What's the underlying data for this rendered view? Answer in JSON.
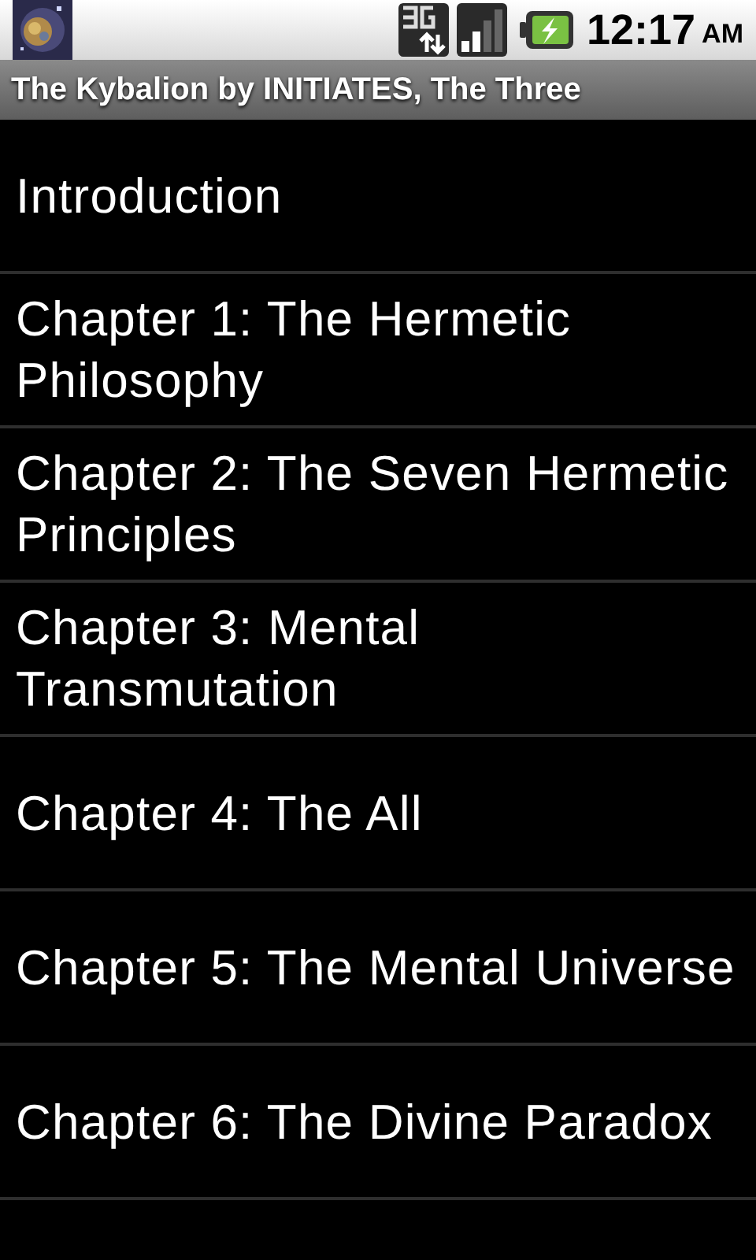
{
  "status_bar": {
    "time": "12:17",
    "meridiem": "AM"
  },
  "title_bar": {
    "title": "The Kybalion by INITIATES, The Three"
  },
  "chapters": [
    {
      "title": "Introduction"
    },
    {
      "title": "Chapter 1: The Hermetic Philosophy"
    },
    {
      "title": "Chapter 2: The Seven Hermetic Principles"
    },
    {
      "title": "Chapter 3: Mental Transmutation"
    },
    {
      "title": "Chapter 4: The All"
    },
    {
      "title": "Chapter 5: The Mental Universe"
    },
    {
      "title": "Chapter 6: The Divine Paradox"
    }
  ]
}
